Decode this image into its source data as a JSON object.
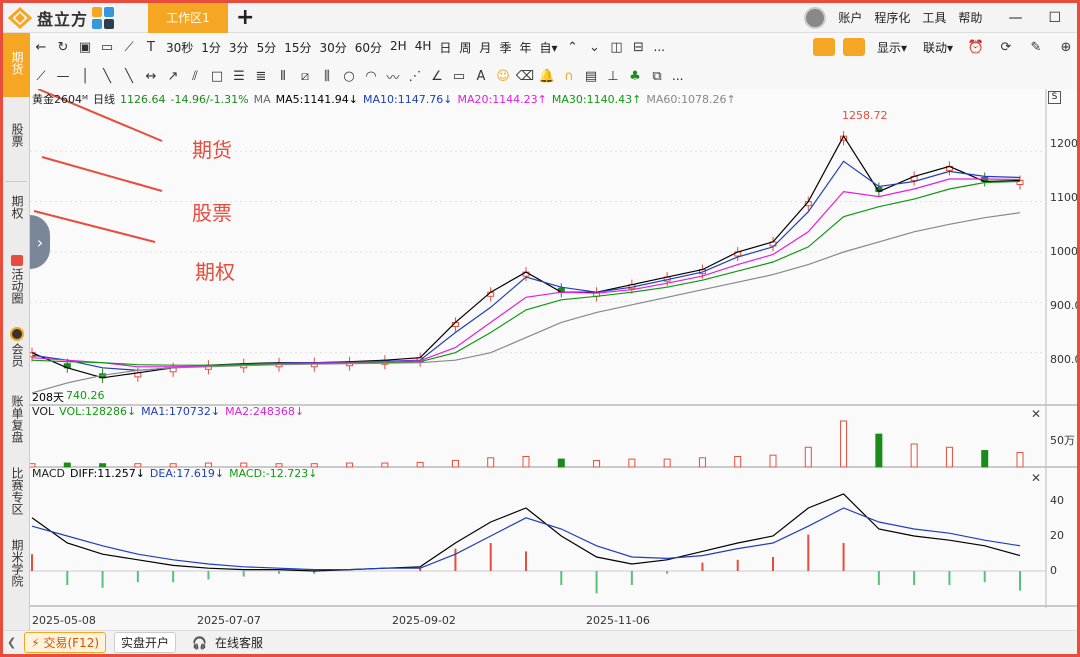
{
  "app": {
    "name": "盘立方",
    "tab": "工作区1",
    "add_tab": "+"
  },
  "title_menu": [
    "账户",
    "程序化",
    "工具",
    "帮助"
  ],
  "window_controls": [
    "—",
    "☐"
  ],
  "sidebar": [
    {
      "label": "期货",
      "active": true
    },
    {
      "label": "股票"
    },
    {
      "label": "期权"
    },
    {
      "label": "活动圈"
    },
    {
      "label": "会员"
    },
    {
      "label": "账单复盘"
    },
    {
      "label": "比赛专区"
    },
    {
      "label": "期米学院"
    }
  ],
  "toolbar1": {
    "periods": [
      "30秒",
      "1分",
      "3分",
      "5分",
      "15分",
      "30分",
      "60分",
      "2H",
      "4H",
      "日",
      "周",
      "月",
      "季",
      "年",
      "自▾"
    ],
    "more": "...",
    "right": [
      "显示▾",
      "联动▾"
    ]
  },
  "toolbar2": {
    "more": "..."
  },
  "legend_main": {
    "symbol": "黄金2604ᴹ",
    "period": "日线",
    "price": "1126.64",
    "change": "-14.96/-1.31%",
    "ma": "MA",
    "ma5": "MA5:1141.94↓",
    "ma10": "MA10:1147.76↓",
    "ma20": "MA20:1144.23↑",
    "ma30": "MA30:1140.43↑",
    "ma60": "MA60:1078.26↑"
  },
  "legend_vol": {
    "name": "VOL",
    "vol": "VOL:128286↓",
    "ma1": "MA1:170732↓",
    "ma2": "MA2:248368↓",
    "unit": "50万"
  },
  "legend_macd": {
    "name": "MACD",
    "diff": "DIFF:11.257↓",
    "dea": "DEA:17.619↓",
    "macd": "MACD:-12.723↓"
  },
  "scale_button": "S",
  "annotations": {
    "high": "1258.72",
    "low": "740.26",
    "days": "208天"
  },
  "annot_labels": [
    "期货",
    "股票",
    "期权"
  ],
  "colors": {
    "up": "#e74c3c",
    "down": "#1a8a1a",
    "ma5": "#000000",
    "ma10": "#1f3fb8",
    "ma20": "#e020e0",
    "ma30": "#119911",
    "ma60": "#888888",
    "accent": "#f5a623"
  },
  "chart_data": {
    "type": "line",
    "title": "",
    "x_ticks": [
      "2025-05-08",
      "2025-07-07",
      "2025-09-02",
      "2025-11-06"
    ],
    "y_ticks": [
      "1200.0",
      "1100.0",
      "1000.0",
      "900.0",
      "800.0"
    ],
    "ylim": [
      700,
      1280
    ],
    "series": [
      {
        "name": "MA5",
        "values": [
          800,
          770,
          750,
          760,
          770,
          775,
          778,
          780,
          780,
          782,
          785,
          790,
          860,
          920,
          960,
          920,
          920,
          935,
          950,
          965,
          1000,
          1020,
          1100,
          1230,
          1120,
          1150,
          1170,
          1140,
          1142
        ]
      },
      {
        "name": "MA10",
        "values": [
          795,
          785,
          770,
          765,
          770,
          774,
          777,
          779,
          780,
          781,
          783,
          785,
          840,
          890,
          950,
          930,
          920,
          930,
          945,
          960,
          990,
          1010,
          1080,
          1180,
          1130,
          1140,
          1160,
          1150,
          1148
        ]
      },
      {
        "name": "MA20",
        "values": [
          790,
          785,
          780,
          772,
          772,
          774,
          776,
          778,
          779,
          780,
          782,
          784,
          810,
          860,
          910,
          920,
          918,
          925,
          938,
          952,
          975,
          995,
          1040,
          1120,
          1110,
          1125,
          1145,
          1145,
          1144
        ]
      },
      {
        "name": "MA30",
        "values": [
          785,
          782,
          780,
          776,
          775,
          775,
          776,
          777,
          778,
          779,
          780,
          782,
          800,
          840,
          885,
          905,
          912,
          920,
          930,
          944,
          962,
          980,
          1010,
          1070,
          1090,
          1105,
          1125,
          1138,
          1140
        ]
      },
      {
        "name": "MA60",
        "values": [
          720,
          740,
          755,
          765,
          770,
          772,
          774,
          776,
          777,
          778,
          779,
          780,
          785,
          800,
          830,
          860,
          880,
          895,
          910,
          925,
          940,
          955,
          975,
          1000,
          1020,
          1040,
          1055,
          1068,
          1078
        ]
      }
    ],
    "volume": [
      5,
      6,
      5,
      5,
      5,
      6,
      6,
      5,
      5,
      6,
      6,
      7,
      10,
      14,
      16,
      12,
      10,
      12,
      12,
      14,
      16,
      18,
      30,
      70,
      50,
      35,
      30,
      25,
      22
    ],
    "macd_diff": [
      38,
      20,
      12,
      8,
      4,
      2,
      1,
      1,
      0,
      1,
      2,
      3,
      20,
      35,
      45,
      25,
      10,
      5,
      8,
      14,
      20,
      25,
      45,
      55,
      30,
      25,
      22,
      18,
      11
    ],
    "macd_dea": [
      32,
      25,
      18,
      12,
      8,
      5,
      3,
      2,
      1,
      1,
      2,
      2,
      12,
      25,
      38,
      30,
      18,
      10,
      9,
      11,
      16,
      20,
      32,
      45,
      35,
      30,
      27,
      22,
      18
    ],
    "macd_ylabels": [
      "40",
      "20",
      "0"
    ]
  },
  "status": {
    "trade": "交易(F12)",
    "open": "实盘开户",
    "service": "在线客服"
  }
}
